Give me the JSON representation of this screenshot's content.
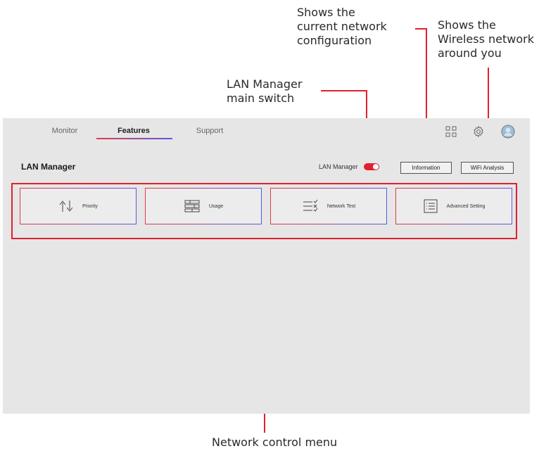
{
  "callouts": {
    "network_config": "Shows the\ncurrent network\nconfiguration",
    "wireless": "Shows the\nWireless network\naround you",
    "main_switch": "LAN Manager\nmain switch",
    "control_menu": "Network control menu"
  },
  "tabs": [
    {
      "label": "Monitor"
    },
    {
      "label": "Features"
    },
    {
      "label": "Support"
    }
  ],
  "header_icons": [
    "grid-icon",
    "gear-icon",
    "avatar"
  ],
  "page": {
    "title": "LAN Manager",
    "switch_label": "LAN Manager",
    "switch_on": true,
    "buttons": {
      "information": "Information",
      "wifi_analysis": "WiFi Analysis"
    }
  },
  "menu": [
    {
      "label": "Priority",
      "icon": "priority-arrows-icon"
    },
    {
      "label": "Usage",
      "icon": "usage-bars-icon"
    },
    {
      "label": "Network Test",
      "icon": "network-test-icon"
    },
    {
      "label": "Advanced Setting",
      "icon": "list-icon"
    }
  ],
  "colors": {
    "accent": "#e0202e",
    "gradient_end": "#5a5adf",
    "app_bg": "#e6e6e6"
  }
}
